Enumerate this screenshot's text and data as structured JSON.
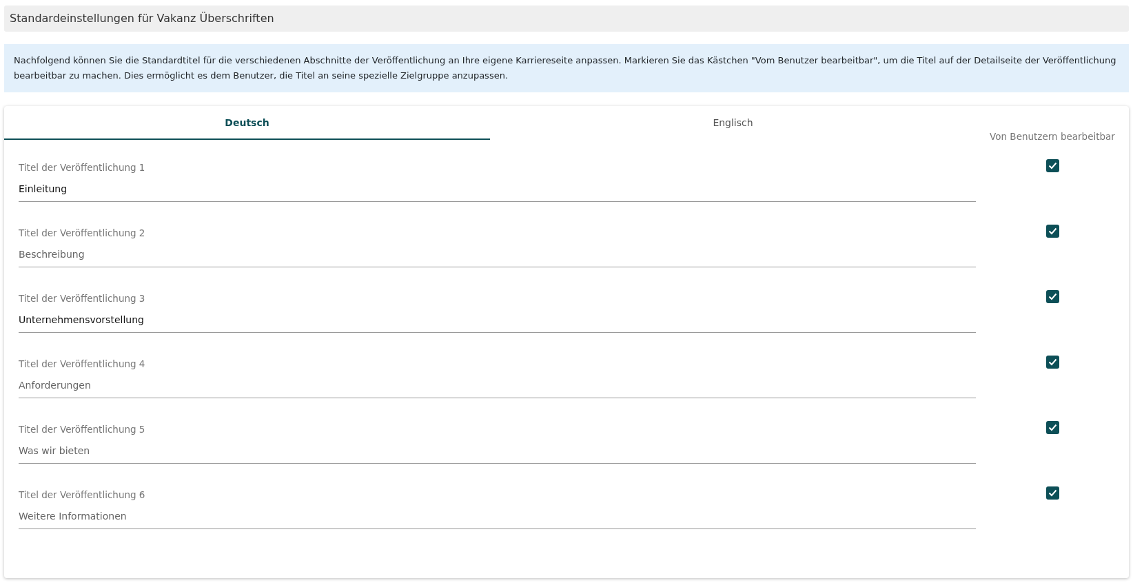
{
  "header": {
    "title": "Standardeinstellungen für Vakanz Überschriften"
  },
  "info": "Nachfolgend können Sie die Standardtitel für die verschiedenen Abschnitte der Veröffentlichung an Ihre eigene Karriereseite anpassen. Markieren Sie das Kästchen \"Vom Benutzer bearbeitbar\", um die Titel auf der Detailseite der Veröffentlichung bearbeitbar zu machen. Dies ermöglicht es dem Benutzer, die Titel an seine spezielle Zielgruppe anzupassen.",
  "tabs": [
    {
      "label": "Deutsch",
      "selected": true
    },
    {
      "label": "Englisch",
      "selected": false
    }
  ],
  "editable_column": {
    "heading": "Von Benutzern bearbeitbar"
  },
  "fields": [
    {
      "label": "Titel der Veröffentlichung 1",
      "value": "Einleitung",
      "checked": true
    },
    {
      "label": "Titel der Veröffentlichung 2",
      "placeholder": "Beschreibung",
      "checked": true
    },
    {
      "label": "Titel der Veröffentlichung 3",
      "value": "Unternehmensvorstellung",
      "checked": true
    },
    {
      "label": "Titel der Veröffentlichung 4",
      "placeholder": "Anforderungen",
      "checked": true
    },
    {
      "label": "Titel der Veröffentlichung 5",
      "placeholder": "Was wir bieten",
      "checked": true
    },
    {
      "label": "Titel der Veröffentlichung 6",
      "placeholder": "Weitere Informationen",
      "checked": true
    }
  ]
}
